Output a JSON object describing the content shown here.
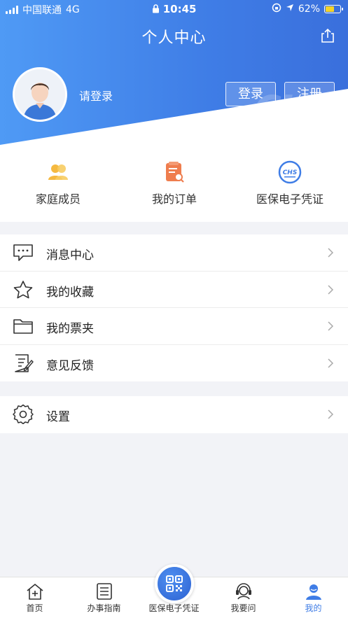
{
  "status_bar": {
    "carrier": "中国联通",
    "network": "4G",
    "time": "10:45",
    "battery": "62%"
  },
  "header": {
    "title": "个人中心",
    "login_hint": "请登录",
    "login_button": "登录",
    "register_button": "注册",
    "watermark": "CHS"
  },
  "quick_actions": [
    {
      "label": "家庭成员",
      "icon": "family-icon"
    },
    {
      "label": "我的订单",
      "icon": "order-icon"
    },
    {
      "label": "医保电子凭证",
      "icon": "chs-logo-icon"
    }
  ],
  "menu_group_1": [
    {
      "label": "消息中心",
      "icon": "message-icon"
    },
    {
      "label": "我的收藏",
      "icon": "star-icon"
    },
    {
      "label": "我的票夹",
      "icon": "folder-icon"
    },
    {
      "label": "意见反馈",
      "icon": "feedback-icon"
    }
  ],
  "menu_group_2": [
    {
      "label": "设置",
      "icon": "gear-icon"
    }
  ],
  "tabbar": {
    "items": [
      {
        "label": "首页",
        "icon": "home-icon"
      },
      {
        "label": "办事指南",
        "icon": "guide-icon"
      },
      {
        "label": "医保电子凭证",
        "icon": "qr-code-icon"
      },
      {
        "label": "我要问",
        "icon": "headset-icon"
      },
      {
        "label": "我的",
        "icon": "user-icon"
      }
    ],
    "active_color": "#3f7de6"
  },
  "colors": {
    "header_gradient_start": "#4f9af5",
    "header_gradient_end": "#3a6fdc",
    "accent": "#3f7de6"
  }
}
